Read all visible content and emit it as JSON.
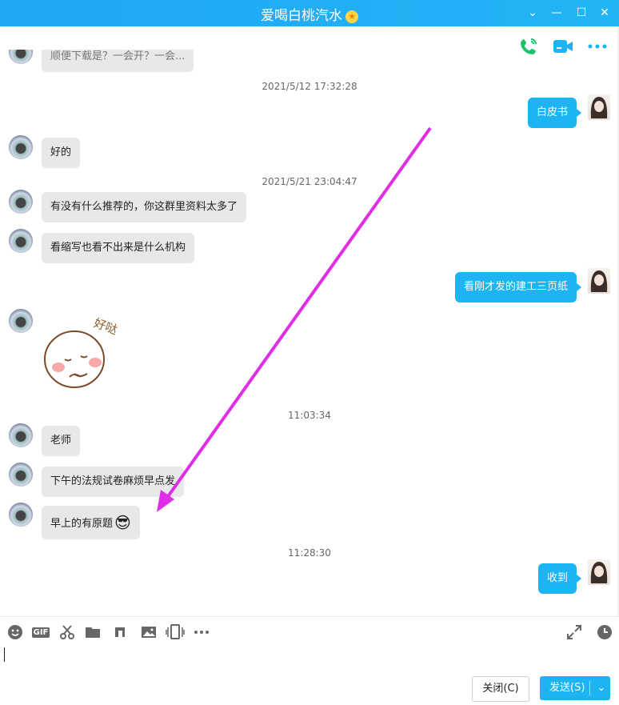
{
  "window": {
    "title": "爱喝白桃汽水",
    "title_badge": "★",
    "controls": {
      "collapse": "⌄",
      "minimize": "—",
      "maximize": "☐",
      "close": "✕"
    }
  },
  "header_actions": [
    {
      "name": "voice-call-icon",
      "color": "#1bc46a"
    },
    {
      "name": "video-call-icon",
      "color": "#1cb4f2"
    },
    {
      "name": "more-icon",
      "color": "#1cb4f2"
    }
  ],
  "messages": {
    "partial_top": "顺便下载是？一会开？一会...",
    "ts1": "2021/5/12 17:32:28",
    "m1": "白皮书",
    "m2": "好的",
    "ts2": "2021/5/21 23:04:47",
    "m3": "有没有什么推荐的，你这群里资料太多了",
    "m4": "看缩写也看不出来是什么机构",
    "m5": "看刚才发的建工三页纸",
    "sticker_text": "好哒",
    "ts3": "11:03:34",
    "m6": "老师",
    "m7": "下午的法规试卷麻烦早点发",
    "m8": "早上的有原题",
    "m8_emoji": "😎",
    "ts4": "11:28:30",
    "m9": "收到"
  },
  "annotation": {
    "arrow_color": "#e02ee6"
  },
  "input_toolbar": [
    "emoji-icon",
    "gif-icon",
    "scissors-icon",
    "folder-icon",
    "music-icon",
    "image-icon",
    "shake-icon",
    "more-tools-icon",
    "expand-icon",
    "history-icon"
  ],
  "input_toolbar_labels": {
    "gif": "GIF"
  },
  "footer": {
    "close_label": "关闭(C)",
    "send_label": "发送(S)",
    "send_dropdown": "⌄"
  }
}
